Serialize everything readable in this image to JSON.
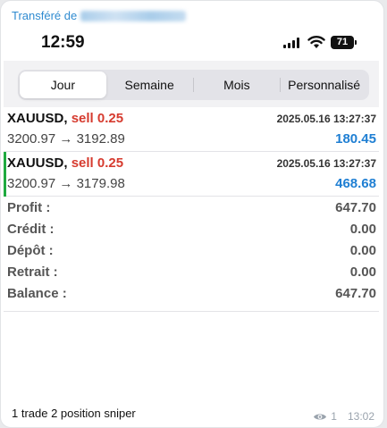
{
  "forward": {
    "label": "Transféré de"
  },
  "status_bar": {
    "time": "12:59",
    "battery": "71"
  },
  "tabs": [
    {
      "label": "Jour",
      "active": true
    },
    {
      "label": "Semaine",
      "active": false
    },
    {
      "label": "Mois",
      "active": false
    },
    {
      "label": "Personnalisé",
      "active": false
    }
  ],
  "trades": [
    {
      "symbol": "XAUUSD,",
      "side": "sell 0.25",
      "time": "2025.05.16 13:27:37",
      "open": "3200.97",
      "arrow": "→",
      "close": "3192.89",
      "profit": "180.45"
    },
    {
      "symbol": "XAUUSD,",
      "side": "sell 0.25",
      "time": "2025.05.16 13:27:37",
      "open": "3200.97",
      "arrow": "→",
      "close": "3179.98",
      "profit": "468.68"
    }
  ],
  "summary": [
    {
      "label": "Profit :",
      "value": "647.70"
    },
    {
      "label": "Crédit :",
      "value": "0.00"
    },
    {
      "label": "Dépôt :",
      "value": "0.00"
    },
    {
      "label": "Retrait :",
      "value": "0.00"
    },
    {
      "label": "Balance :",
      "value": "647.70"
    }
  ],
  "message": {
    "caption": "1 trade 2 position sniper",
    "views": "1",
    "time": "13:02"
  },
  "colors": {
    "sell": "#d63b2f",
    "profit": "#1f7fd3",
    "link": "#2f8bd0",
    "active_bar": "#1faa3f"
  }
}
